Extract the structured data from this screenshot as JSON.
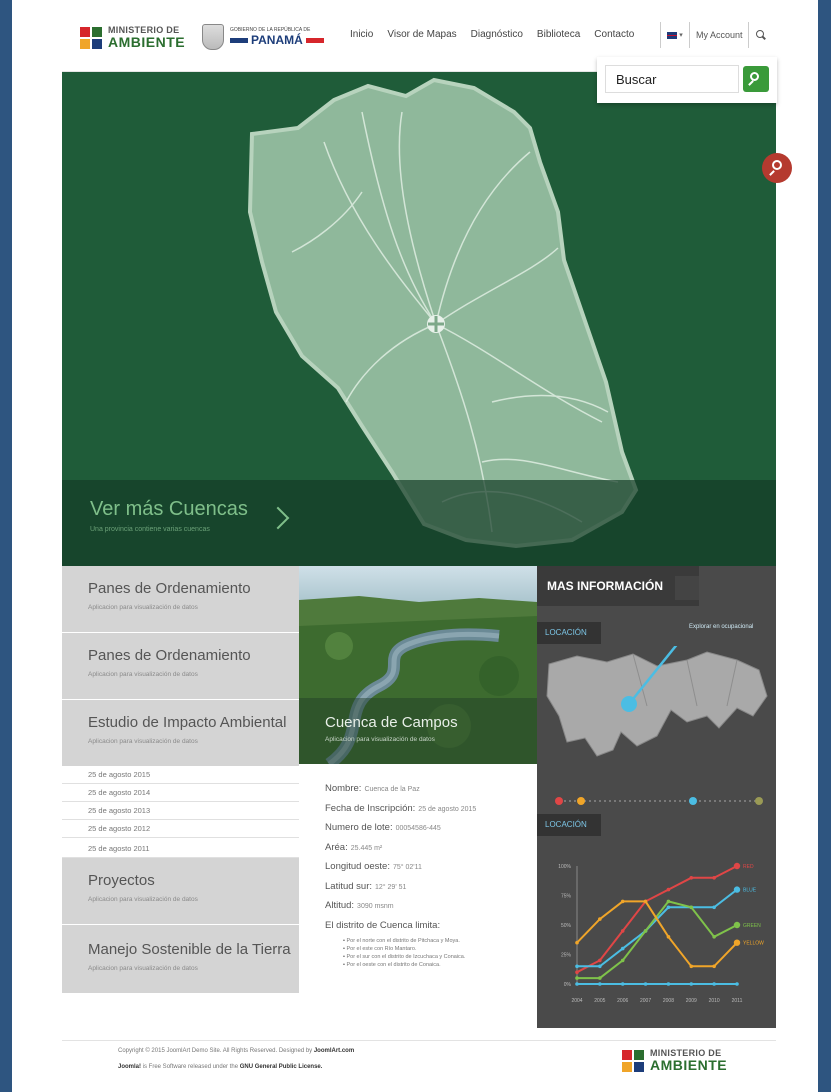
{
  "header": {
    "brand_small": "MINISTERIO DE",
    "brand_big": "AMBIENTE",
    "gov_small": "GOBIERNO DE LA REPÚBLICA DE",
    "gov_big": "PANAMÁ",
    "nav": [
      "Inicio",
      "Visor de Mapas",
      "Diagnóstico",
      "Biblioteca",
      "Contacto"
    ],
    "account": "My Account",
    "search_value": "Buscar"
  },
  "hero": {
    "title": "Ver más Cuencas",
    "subtitle": "Una provincia contiene varias cuencas"
  },
  "panels": {
    "p1": {
      "title": "Panes de Ordenamiento",
      "sub": "Aplicacion para visualización de datos"
    },
    "p2": {
      "title": "Panes de Ordenamiento",
      "sub": "Aplicacion para visualización de datos"
    },
    "p3": {
      "title": "Estudio de Impacto Ambiental",
      "sub": "Aplicacion para visualización de datos"
    },
    "p4": {
      "title": "Proyectos",
      "sub": "Aplicacion para visualización de datos"
    },
    "p5": {
      "title": "Manejo Sostenible de la Tierra",
      "sub": "Aplicacion para visualización de datos"
    }
  },
  "dates": [
    "25 de agosto 2015",
    "25 de agosto 2014",
    "25 de agosto 2013",
    "25 de agosto 2012",
    "25 de agosto 2011"
  ],
  "photo": {
    "title": "Cuenca de Campos",
    "sub": "Aplicacion para visualización de datos"
  },
  "info": {
    "nombre_label": "Nombre:",
    "nombre": "Cuenca de la Paz",
    "fecha_label": "Fecha de Inscripción:",
    "fecha": "25 de agosto 2015",
    "lote_label": "Numero de lote:",
    "lote": "00054586-445",
    "area_label": "Aréa:",
    "area": "25.445 m²",
    "long_label": "Longitud oeste:",
    "long": "75° 02'11",
    "lat_label": "Latitud sur:",
    "lat": "12° 29' 51",
    "alt_label": "Altitud:",
    "alt": "3090 msnm",
    "distrito": "El distrito de Cuenca limita:",
    "limits": [
      "Por el norte con el distrito de Pitchaca y Moya.",
      "Por el este con Río Mantaro.",
      "Por el sur con el distrito de Izcuchaca y Conaica.",
      "Por el oeste con el distrito de Conaica."
    ]
  },
  "side": {
    "title": "MAS INFORMACIÓN",
    "loc1": "LOCACIÓN",
    "loc2": "LOCACIÓN",
    "explore": "Explorar en ocupacional"
  },
  "chart_data": {
    "type": "line",
    "x": [
      "2004",
      "2005",
      "2006",
      "2007",
      "2008",
      "2009",
      "2010",
      "2011"
    ],
    "ylim": [
      0,
      100
    ],
    "yticks": [
      "100%",
      "75%",
      "50%",
      "25%",
      "0%"
    ],
    "series": [
      {
        "name": "RED",
        "color": "#e04646",
        "values": [
          10,
          20,
          45,
          70,
          80,
          90,
          90,
          100
        ]
      },
      {
        "name": "BLUE",
        "color": "#4bbde3",
        "values": [
          15,
          15,
          30,
          45,
          65,
          65,
          65,
          80
        ]
      },
      {
        "name": "GREEN",
        "color": "#7fc24a",
        "values": [
          5,
          5,
          20,
          45,
          70,
          65,
          40,
          50
        ]
      },
      {
        "name": "YELLOW",
        "color": "#f0a529",
        "values": [
          35,
          55,
          70,
          70,
          40,
          15,
          15,
          35
        ]
      },
      {
        "name": "",
        "color": "#4bbde3",
        "values": [
          0,
          0,
          0,
          0,
          0,
          0,
          0,
          0
        ]
      }
    ]
  },
  "timeline_colors": [
    "#e04646",
    "#f0a529",
    "#4bbde3",
    "#9a9a55"
  ],
  "footer": {
    "copy": "Copyright © 2015 JoomlArt Demo Site. All Rights Reserved. Designed by ",
    "copy_link": "JoomlArt.com",
    "joomla": "Joomla!",
    "joomla_text": " is Free Software released under the ",
    "gpl": "GNU General Public License."
  }
}
